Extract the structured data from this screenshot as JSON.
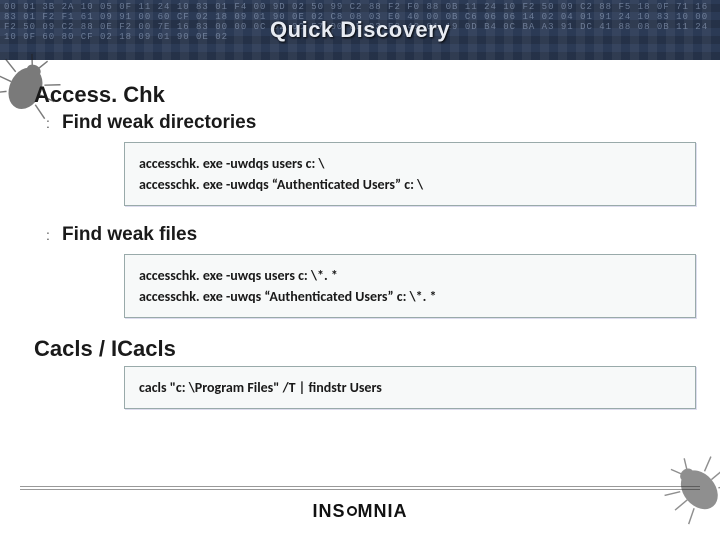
{
  "header": {
    "title": "Quick Discovery",
    "hex_filler": "00 01 3B 2A 10 05 0F 11 24 10 83 01 F4 00 9D 02 50 99 C2 88 F2 F0 88 0B 11 24 10 F2 50 09 C2 88 F5 18 0F 71 16 83 01 F2 F1 61 09 91 00 60 CF 02 18 09 01 90 0E 02 C8 08 03 E0 40 00 0B C6 06 06 14 02 04 01 91 24 10 83 10 00 F2 50 09 C2 88 0E F2 00 7E 16 83 00 00 0C 82 0C F7 00 0E 03 E0 40 01 19 0D B4 0C BA A3 91 DC 41 88 08 0B 11 24 10 0F 60 80 CF 02 18 09 01 90 0E 02"
  },
  "sections": [
    {
      "tool": "Access. Chk",
      "subs": [
        {
          "label": "Find weak directories",
          "commands": "accesschk. exe -uwdqs users c: \\\naccesschk. exe -uwdqs “Authenticated Users” c: \\"
        },
        {
          "label": "Find weak files",
          "commands": "accesschk. exe -uwqs users c: \\*. *\naccesschk. exe -uwqs “Authenticated Users” c: \\*. *"
        }
      ]
    },
    {
      "tool": "Cacls / ICacls",
      "subs": [
        {
          "label": "",
          "commands": "cacls \"c: \\Program Files\" /T | findstr Users"
        }
      ]
    }
  ],
  "footer": {
    "brand_left": "INS",
    "brand_right": "MNIA"
  }
}
